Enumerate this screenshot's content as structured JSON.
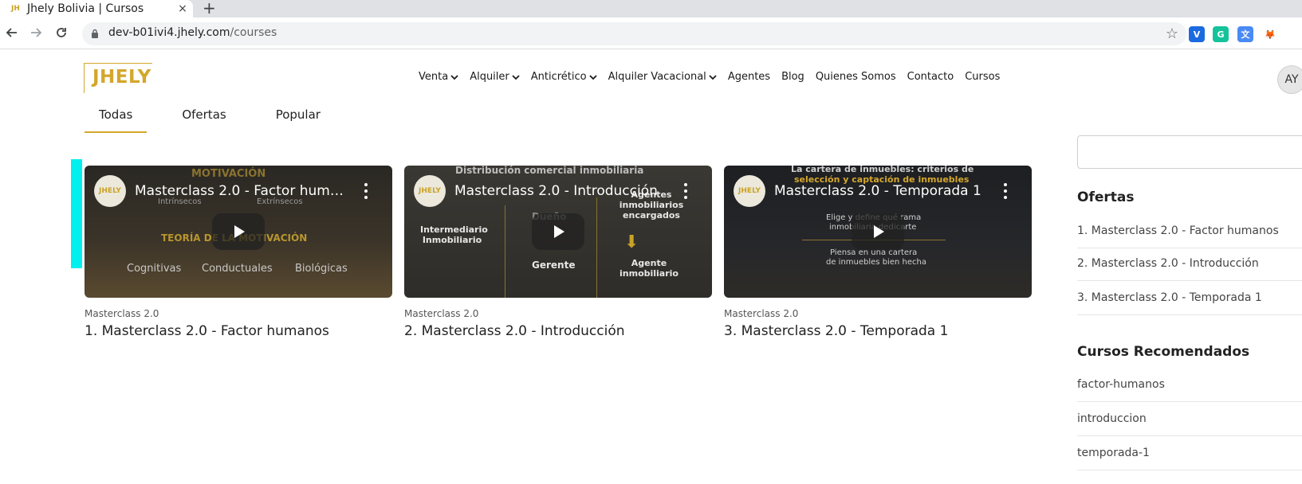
{
  "browser": {
    "tab_favicon": "JH",
    "tab_title": "Jhely Bolivia | Cursos",
    "tab_close": "×",
    "new_tab": "+",
    "url_host": "dev-b01ivi4.jhely.com",
    "url_path": "/courses",
    "star": "☆",
    "extensions": [
      {
        "name": "vimeo-extension",
        "glyph": "V",
        "color": "#1b6ae0"
      },
      {
        "name": "grammarly-extension",
        "glyph": "G",
        "color": "#15c39a"
      },
      {
        "name": "translate-extension",
        "glyph": "文",
        "color": "#4a8af4"
      },
      {
        "name": "metamask-extension",
        "glyph": "🦊",
        "color": "#ffffff"
      }
    ]
  },
  "site": {
    "logo": "JHELY",
    "nav": [
      {
        "label": "Venta",
        "dropdown": true
      },
      {
        "label": "Alquiler",
        "dropdown": true
      },
      {
        "label": "Anticrético",
        "dropdown": true
      },
      {
        "label": "Alquiler Vacacional",
        "dropdown": true
      },
      {
        "label": "Agentes",
        "dropdown": false
      },
      {
        "label": "Blog",
        "dropdown": false
      },
      {
        "label": "Quienes Somos",
        "dropdown": false
      },
      {
        "label": "Contacto",
        "dropdown": false
      },
      {
        "label": "Cursos",
        "dropdown": false
      }
    ],
    "avatar": "AY"
  },
  "filters": {
    "items": [
      "Todas",
      "Ofertas",
      "Popular"
    ],
    "active": "Todas"
  },
  "courses": [
    {
      "channel_icon": "JHELY",
      "video_title": "Masterclass 2.0 - Factor huma...",
      "category": "Masterclass 2.0",
      "title": "1. Masterclass 2.0 - Factor humanos",
      "thumb_texts": {
        "top": "MOTIVACIÓN",
        "left": "Intrínsecos",
        "right": "Extrínsecos",
        "middle": "TEORÍA DE LA MOTIVACIÓN",
        "b1": "Cognitivas",
        "b2": "Conductuales",
        "b3": "Biológicas"
      }
    },
    {
      "channel_icon": "JHELY",
      "video_title": "Masterclass 2.0 - Introducción",
      "category": "Masterclass 2.0",
      "title": "2. Masterclass 2.0 - Introducción",
      "thumb_texts": {
        "top": "Distribución comercial inmobiliaria",
        "left": "Intermediario Inmobiliario",
        "center": "Dueño",
        "right": "Agentes inmobiliarios encargados",
        "bottom_center": "Gerente",
        "bottom_right": "Agente inmobiliario"
      }
    },
    {
      "channel_icon": "JHELY",
      "video_title": "Masterclass 2.0 - Temporada 1",
      "category": "Masterclass 2.0",
      "title": "3. Masterclass 2.0 - Temporada 1",
      "thumb_texts": {
        "top1": "La cartera de inmuebles: criterios de",
        "top2": "selección y captación de inmuebles",
        "mid1": "Elige y define qué rama",
        "mid2": "inmobiliaria dedicarte",
        "low1": "Piensa en una cartera",
        "low2": "de inmuebles bien hecha"
      }
    }
  ],
  "sidebar": {
    "offers_heading": "Ofertas",
    "offers": [
      "1. Masterclass 2.0 - Factor humanos",
      "2. Masterclass 2.0 - Introducción",
      "3. Masterclass 2.0 - Temporada 1"
    ],
    "recommended_heading": "Cursos Recomendados",
    "recommended": [
      "factor-humanos",
      "introduccion",
      "temporada-1"
    ]
  }
}
